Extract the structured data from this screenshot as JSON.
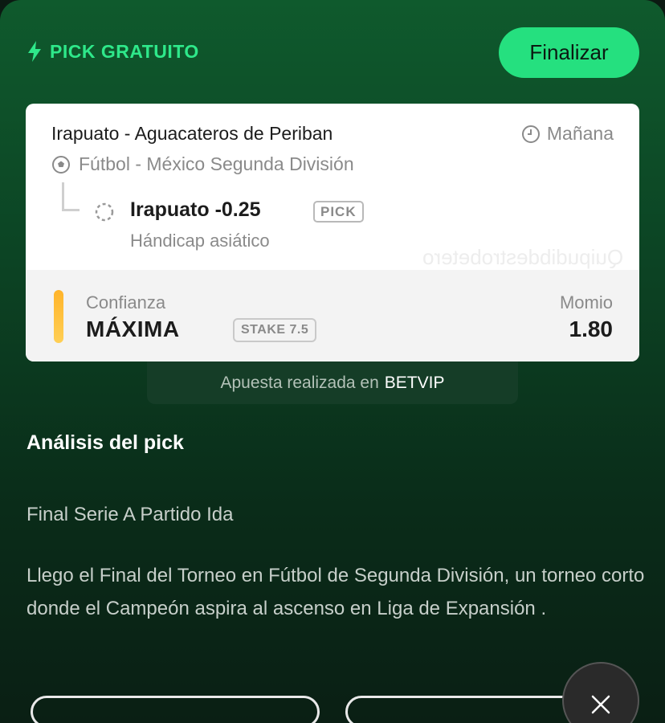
{
  "header": {
    "title": "PICK GRATUITO",
    "icon": "lightning-bolt-icon",
    "finalize_label": "Finalizar"
  },
  "colors": {
    "accent": "#25e07f",
    "confidence_bar": "#ffc03a",
    "background_top": "#0f5a2d",
    "background_bottom": "#0a1f14"
  },
  "pick_card": {
    "match": "Irapuato - Aguacateros de Periban",
    "time": "Mañana",
    "sport_league": "Fútbol - México Segunda División",
    "pick": "Irapuato -0.25",
    "pick_badge": "PICK",
    "market": "Hándicap asiático",
    "watermark": "Quipudibdestrobetero",
    "confidence_label": "Confianza",
    "confidence_value": "MÁXIMA",
    "stake_label": "STAKE 7.5",
    "odds_label": "Momio",
    "odds_value": "1.80"
  },
  "bet_placed": {
    "prefix": "Apuesta realizada en",
    "bookmaker": "BETVIP"
  },
  "analysis": {
    "title": "Análisis del pick",
    "subtitle": "Final Serie A Partido Ida",
    "body": "Llego el Final del Torneo en Fútbol de Segunda División, un torneo corto donde el Campeón aspira al ascenso en Liga de Expansión ."
  }
}
